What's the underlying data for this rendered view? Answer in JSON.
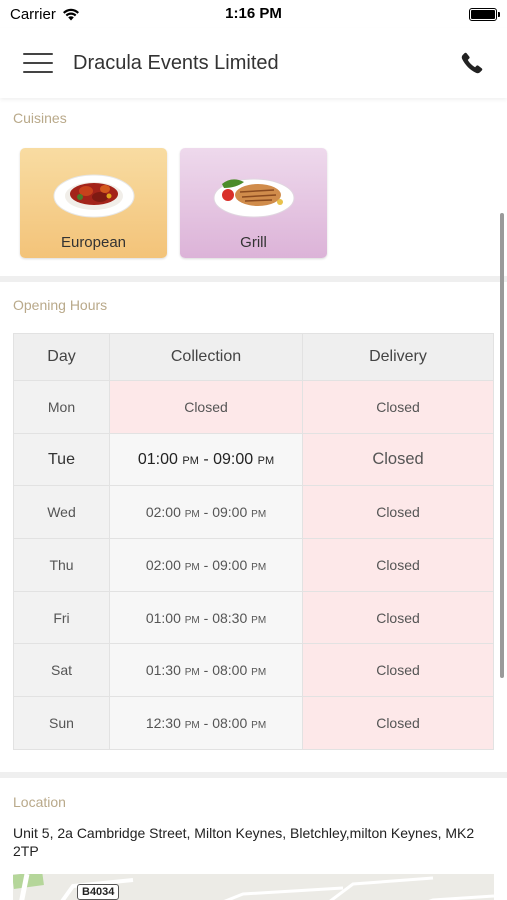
{
  "status": {
    "carrier": "Carrier",
    "time": "1:16 PM"
  },
  "header": {
    "title": "Dracula Events Limited"
  },
  "cuisines": {
    "title": "Cuisines",
    "items": [
      {
        "label": "European"
      },
      {
        "label": "Grill"
      }
    ]
  },
  "hours": {
    "title": "Opening Hours",
    "headers": {
      "day": "Day",
      "collection": "Collection",
      "delivery": "Delivery"
    },
    "rows": [
      {
        "day": "Mon",
        "collection": "Closed",
        "delivery": "Closed"
      },
      {
        "day": "Tue",
        "coll_start": "01:00",
        "coll_start_ap": "PM",
        "sep": "-",
        "coll_end": "09:00",
        "coll_end_ap": "PM",
        "delivery": "Closed"
      },
      {
        "day": "Wed",
        "coll_start": "02:00",
        "coll_start_ap": "PM",
        "sep": "-",
        "coll_end": "09:00",
        "coll_end_ap": "PM",
        "delivery": "Closed"
      },
      {
        "day": "Thu",
        "coll_start": "02:00",
        "coll_start_ap": "PM",
        "sep": "-",
        "coll_end": "09:00",
        "coll_end_ap": "PM",
        "delivery": "Closed"
      },
      {
        "day": "Fri",
        "coll_start": "01:00",
        "coll_start_ap": "PM",
        "sep": "-",
        "coll_end": "08:30",
        "coll_end_ap": "PM",
        "delivery": "Closed"
      },
      {
        "day": "Sat",
        "coll_start": "01:30",
        "coll_start_ap": "PM",
        "sep": "-",
        "coll_end": "08:00",
        "coll_end_ap": "PM",
        "delivery": "Closed"
      },
      {
        "day": "Sun",
        "coll_start": "12:30",
        "coll_start_ap": "PM",
        "sep": "-",
        "coll_end": "08:00",
        "coll_end_ap": "PM",
        "delivery": "Closed"
      }
    ]
  },
  "location": {
    "title": "Location",
    "address": "Unit 5, 2a Cambridge Street, Milton Keynes, Bletchley,milton Keynes, MK2 2TP",
    "map_road_label": "B4034"
  },
  "colors": {
    "accent_text": "#4ec9c5",
    "closed_bg": "#fde8e9",
    "section_title": "#b9a98a"
  }
}
